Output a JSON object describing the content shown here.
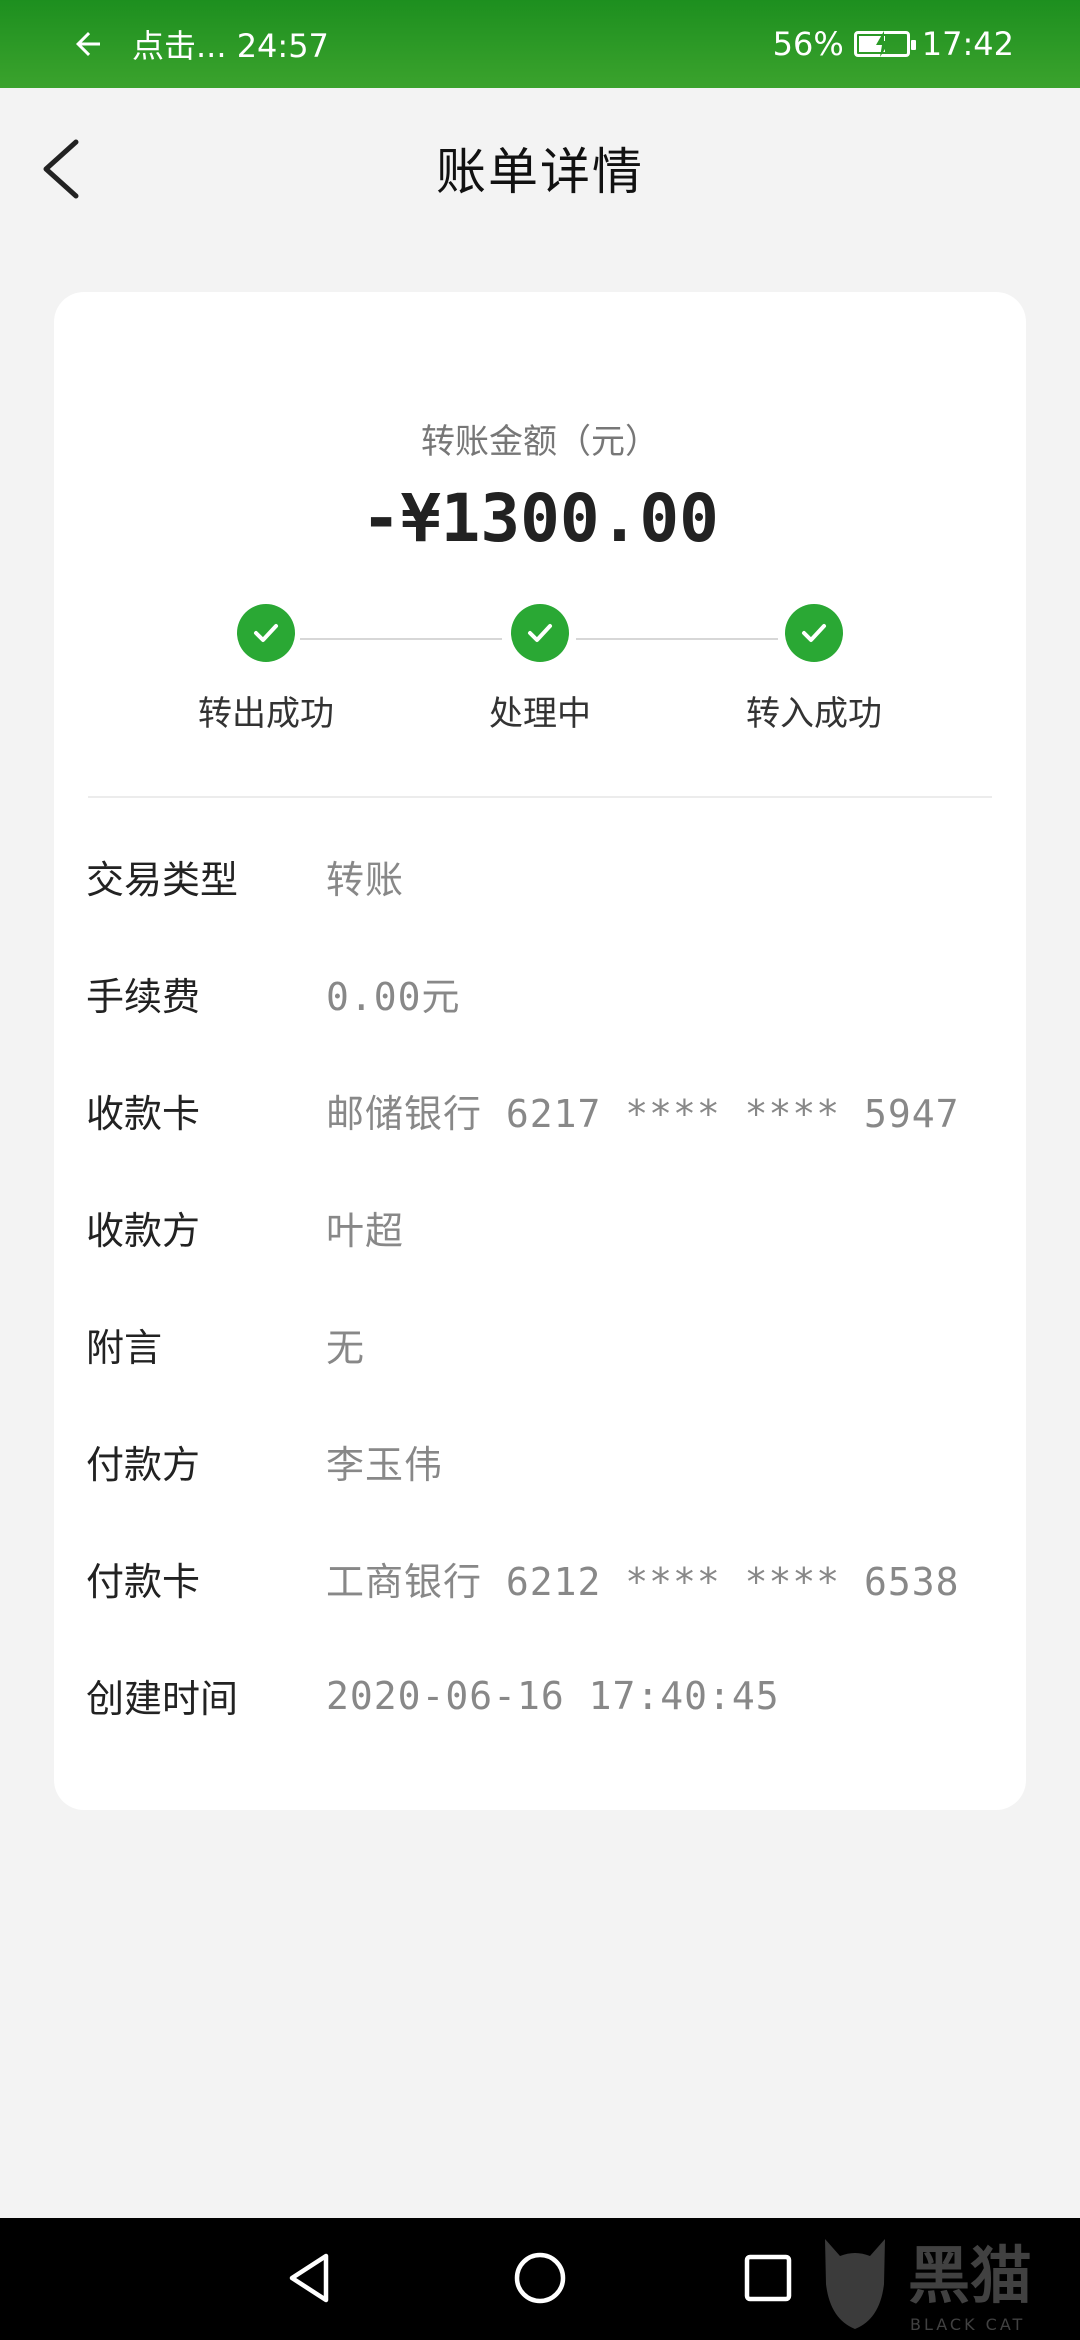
{
  "status_bar": {
    "left_text": "点击... 24:57",
    "battery_percent_label": "56%",
    "battery_level": 0.56,
    "time": "17:42"
  },
  "header": {
    "title": "账单详情"
  },
  "amount_section": {
    "label": "转账金额（元）",
    "amount": "-¥1300.00"
  },
  "steps": [
    {
      "label": "转出成功",
      "done": true
    },
    {
      "label": "处理中",
      "done": true
    },
    {
      "label": "转入成功",
      "done": true
    }
  ],
  "details": [
    {
      "label": "交易类型",
      "value": "转账"
    },
    {
      "label": "手续费",
      "value": "0.00元"
    },
    {
      "label": "收款卡",
      "value": "邮储银行 6217 **** **** 5947"
    },
    {
      "label": "收款方",
      "value": "叶超"
    },
    {
      "label": "附言",
      "value": "无"
    },
    {
      "label": "付款方",
      "value": "李玉伟"
    },
    {
      "label": "付款卡",
      "value": "工商银行 6212 **** **** 6538"
    },
    {
      "label": "创建时间",
      "value": "2020-06-16 17:40:45"
    }
  ],
  "watermark": {
    "text": "黑猫",
    "subtext": "BLACK CAT"
  },
  "colors": {
    "status_green": "#2a9a26",
    "check_green": "#2aa834",
    "background": "#f3f3f3"
  }
}
